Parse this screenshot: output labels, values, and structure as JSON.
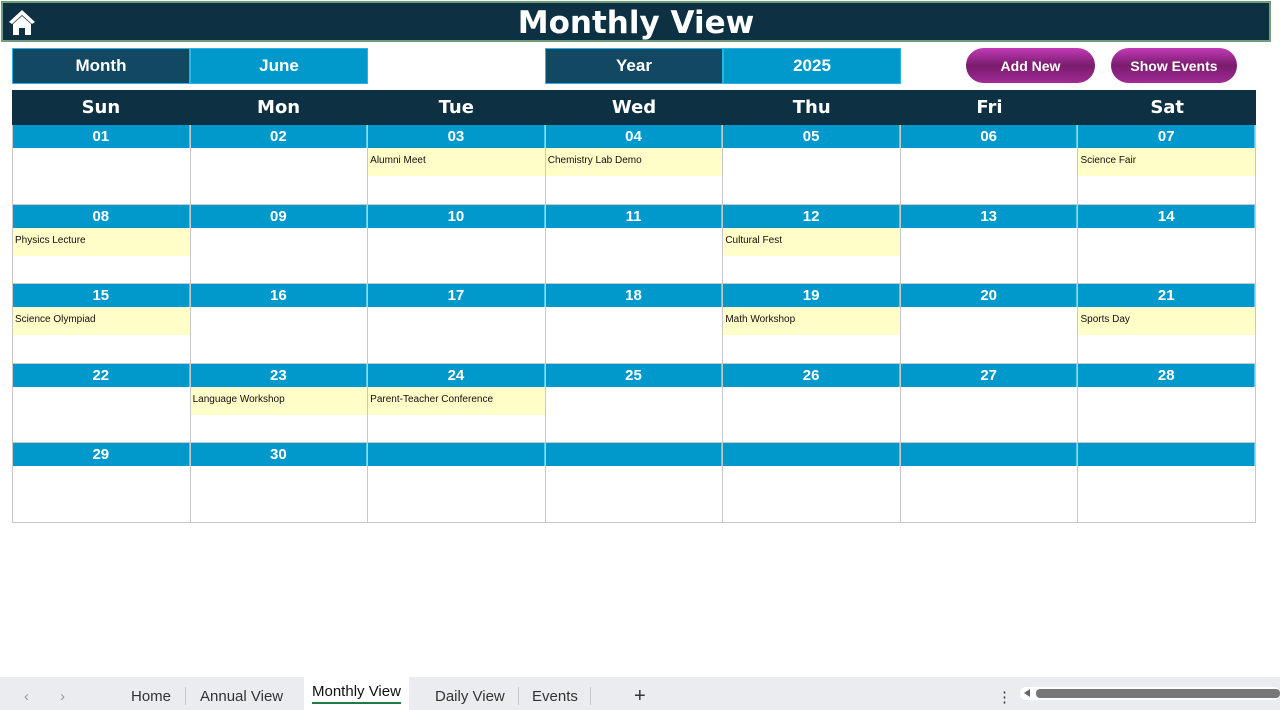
{
  "header": {
    "title": "Monthly View",
    "home_icon": "home-icon"
  },
  "controls": {
    "month_label": "Month",
    "month_value": "June",
    "year_label": "Year",
    "year_value": "2025",
    "add_new": "Add New",
    "show_events": "Show Events"
  },
  "colors": {
    "header": "#0d3042",
    "label": "#134863",
    "value": "#0199cc",
    "event": "#fffdc8",
    "button": "#9b2a8f"
  },
  "weekdays": [
    "Sun",
    "Mon",
    "Tue",
    "Wed",
    "Thu",
    "Fri",
    "Sat"
  ],
  "weeks": [
    [
      {
        "day": "01",
        "event": ""
      },
      {
        "day": "02",
        "event": ""
      },
      {
        "day": "03",
        "event": "Alumni Meet"
      },
      {
        "day": "04",
        "event": "Chemistry Lab Demo"
      },
      {
        "day": "05",
        "event": ""
      },
      {
        "day": "06",
        "event": ""
      },
      {
        "day": "07",
        "event": "Science Fair"
      }
    ],
    [
      {
        "day": "08",
        "event": "Physics Lecture"
      },
      {
        "day": "09",
        "event": ""
      },
      {
        "day": "10",
        "event": ""
      },
      {
        "day": "11",
        "event": ""
      },
      {
        "day": "12",
        "event": "Cultural Fest"
      },
      {
        "day": "13",
        "event": ""
      },
      {
        "day": "14",
        "event": ""
      }
    ],
    [
      {
        "day": "15",
        "event": "Science Olympiad"
      },
      {
        "day": "16",
        "event": ""
      },
      {
        "day": "17",
        "event": ""
      },
      {
        "day": "18",
        "event": ""
      },
      {
        "day": "19",
        "event": "Math Workshop"
      },
      {
        "day": "20",
        "event": ""
      },
      {
        "day": "21",
        "event": "Sports Day"
      }
    ],
    [
      {
        "day": "22",
        "event": ""
      },
      {
        "day": "23",
        "event": "Language Workshop"
      },
      {
        "day": "24",
        "event": "Parent-Teacher Conference"
      },
      {
        "day": "25",
        "event": ""
      },
      {
        "day": "26",
        "event": ""
      },
      {
        "day": "27",
        "event": ""
      },
      {
        "day": "28",
        "event": ""
      }
    ],
    [
      {
        "day": "29",
        "event": ""
      },
      {
        "day": "30",
        "event": ""
      },
      {
        "day": "",
        "event": ""
      },
      {
        "day": "",
        "event": ""
      },
      {
        "day": "",
        "event": ""
      },
      {
        "day": "",
        "event": ""
      },
      {
        "day": "",
        "event": ""
      }
    ]
  ],
  "sheet_tabs": {
    "items": [
      "Home",
      "Annual View",
      "Monthly View",
      "Daily View",
      "Events"
    ],
    "active": "Monthly View",
    "add": "+",
    "more": "⋮"
  }
}
